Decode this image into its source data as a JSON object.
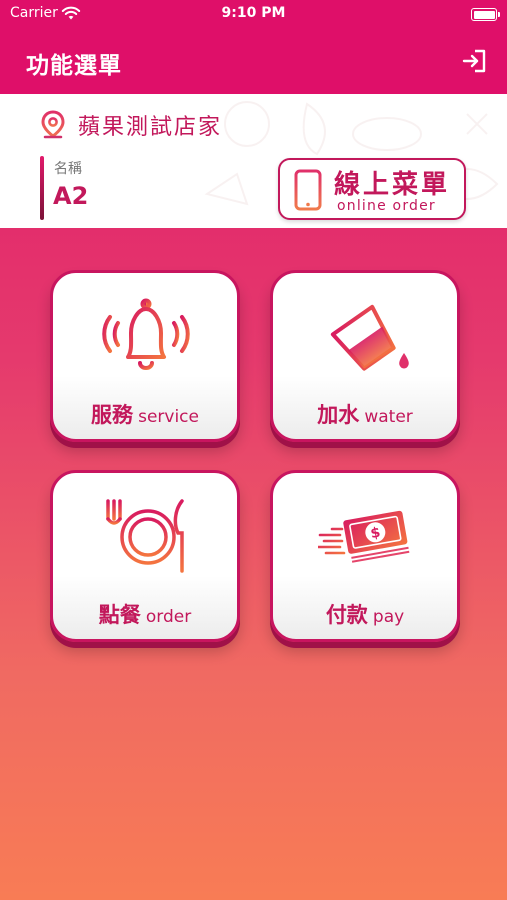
{
  "status_bar": {
    "carrier": "Carrier",
    "time": "9:10 PM"
  },
  "nav": {
    "title": "功能選單",
    "logout_icon": "logout-icon"
  },
  "store": {
    "name": "蘋果測試店家"
  },
  "table": {
    "label": "名稱",
    "value": "A2"
  },
  "online_order": {
    "title": "線上菜單",
    "subtitle": "online order"
  },
  "tiles": [
    {
      "zh": "服務",
      "en": "service",
      "icon": "bell-icon"
    },
    {
      "zh": "加水",
      "en": "water",
      "icon": "water-glass-icon"
    },
    {
      "zh": "點餐",
      "en": "order",
      "icon": "dining-icon"
    },
    {
      "zh": "付款",
      "en": "pay",
      "icon": "money-icon"
    }
  ],
  "colors": {
    "brand": "#df0f69",
    "accent": "#c2185b",
    "gradient_end": "#f87c55"
  }
}
